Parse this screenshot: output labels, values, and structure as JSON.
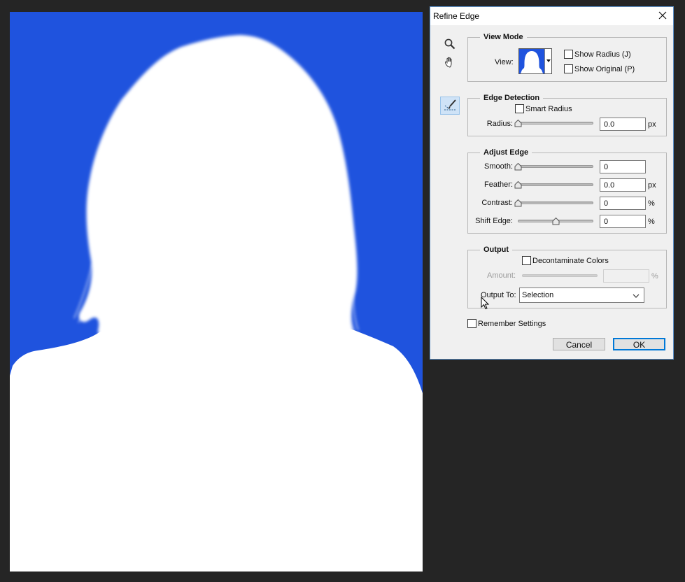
{
  "dialog": {
    "title": "Refine Edge",
    "view_mode": {
      "legend": "View Mode",
      "view_label": "View:",
      "show_radius": "Show Radius (J)",
      "show_original": "Show Original (P)"
    },
    "edge_detection": {
      "legend": "Edge Detection",
      "smart_radius": "Smart Radius",
      "radius_label": "Radius:",
      "radius_value": "0.0",
      "radius_unit": "px"
    },
    "adjust_edge": {
      "legend": "Adjust Edge",
      "smooth_label": "Smooth:",
      "smooth_value": "0",
      "feather_label": "Feather:",
      "feather_value": "0.0",
      "feather_unit": "px",
      "contrast_label": "Contrast:",
      "contrast_value": "0",
      "contrast_unit": "%",
      "shift_label": "Shift Edge:",
      "shift_value": "0",
      "shift_unit": "%"
    },
    "output": {
      "legend": "Output",
      "decontaminate": "Decontaminate Colors",
      "amount_label": "Amount:",
      "amount_unit": "%",
      "output_to_label": "Output To:",
      "output_to_value": "Selection"
    },
    "remember_settings": "Remember Settings",
    "cancel": "Cancel",
    "ok": "OK"
  },
  "colors": {
    "canvas_background": "#1f53de",
    "subject_mask": "#ffffff",
    "app_background": "#252525",
    "dialog_background": "#f0f0f0",
    "focus_accent": "#0078d7"
  },
  "icons": {
    "zoom_tool": "magnifier-icon",
    "hand_tool": "hand-icon",
    "refine_brush": "refine-radius-brush-icon",
    "close": "close-icon",
    "dropdown": "chevron-down-icon"
  }
}
